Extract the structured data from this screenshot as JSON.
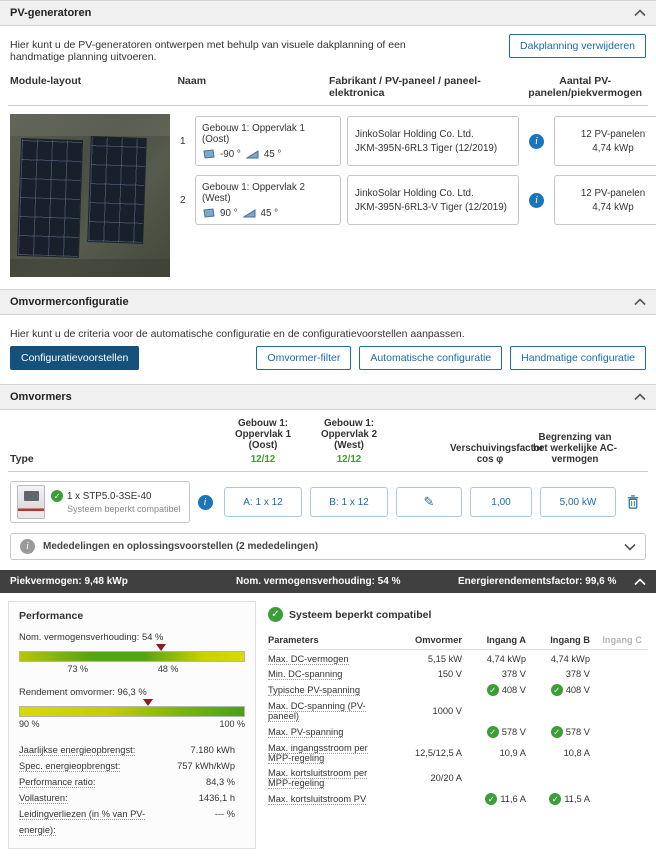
{
  "icons": {
    "check": "✓",
    "info": "i",
    "pencil": "✎"
  },
  "colors": {
    "accent": "#1b6ca8",
    "primary_button": "#14527d",
    "status_green": "#3c9e36",
    "summary_bar": "#404040",
    "marker_red": "#8c1d1d"
  },
  "pv_generators": {
    "title": "PV-generatoren",
    "description": "Hier kunt u de PV-generatoren ontwerpen met behulp van visuele dakplanning of een handmatige planning uitvoeren.",
    "remove_button": "Dakplanning verwijderen",
    "columns": [
      "Module-layout",
      "Naam",
      "Fabrikant / PV-paneel / paneel-elektronica",
      "Aantal PV-panelen/piekvermogen"
    ],
    "rows": [
      {
        "index": "1",
        "name": "Gebouw 1: Oppervlak 1 (Oost)",
        "azimuth": "-90 °",
        "tilt": "45 °",
        "manufacturer": "JinkoSolar Holding Co. Ltd.",
        "panel": "JKM-395N-6RL3 Tiger (12/2019)",
        "count": "12 PV-panelen",
        "power": "4,74 kWp"
      },
      {
        "index": "2",
        "name": "Gebouw 1: Oppervlak 2 (West)",
        "azimuth": "90 °",
        "tilt": "45 °",
        "manufacturer": "JinkoSolar Holding Co. Ltd.",
        "panel": "JKM-395N-6RL3-V Tiger (12/2019)",
        "count": "12 PV-panelen",
        "power": "4,74 kWp"
      }
    ]
  },
  "inverter_config": {
    "title": "Omvormerconfiguratie",
    "description": "Hier kunt u de criteria voor de automatische configuratie en de configuratievoorstellen aanpassen.",
    "buttons": {
      "proposals": "Configuratievoorstellen",
      "filter": "Omvormer-filter",
      "automatic": "Automatische configuratie",
      "manual": "Handmatige configuratie"
    }
  },
  "inverters": {
    "title": "Omvormers",
    "columns": {
      "type": "Type",
      "surface1": "Gebouw 1: Oppervlak 1 (Oost)",
      "surface1_count": "12/12",
      "surface2": "Gebouw 1: Oppervlak 2 (West)",
      "surface2_count": "12/12",
      "cos_phi": "Verschuivingsfactor cos φ",
      "ac_limit": "Begrenzing van het werkelijke AC-vermogen"
    },
    "row": {
      "type_name": "1 x STP5.0-3SE-40",
      "type_status": "Systeem beperkt compatibel",
      "input_a": "A: 1 x 12",
      "input_b": "B: 1 x 12",
      "cos_phi": "1,00",
      "ac_limit": "5,00 kW"
    },
    "messages_label": "Mededelingen en oplossingsvoorstellen (2 mededelingen)"
  },
  "summary_bar": {
    "peak_power": "Piekvermogen: 9,48 kWp",
    "nominal_ratio": "Nom. vermogensverhouding: 54 %",
    "energy_factor": "Energierendementsfactor: 99,6 %"
  },
  "performance": {
    "title": "Performance",
    "nominal_ratio": {
      "label": "Nom. vermogensverhouding: 54 %",
      "tick_left": "73 %",
      "tick_right": "48 %"
    },
    "inverter_efficiency": {
      "label": "Rendement omvormer: 96,3 %",
      "tick_left": "90 %",
      "tick_right": "100 %"
    },
    "stats": [
      {
        "label": "Jaarlijkse energieopbrengst:",
        "value": "7.180 kWh"
      },
      {
        "label": "Spec. energieopbrengst:",
        "value": "757 kWh/kWp"
      },
      {
        "label": "Performance ratio:",
        "value": "84,3 %"
      },
      {
        "label": "Vollasturen:",
        "value": "1436,1 h"
      },
      {
        "label": "Leidingverliezen (in % van PV-energie):",
        "value": "--- %"
      }
    ]
  },
  "system_check": {
    "title": "Systeem beperkt compatibel",
    "columns": [
      "Parameters",
      "Omvormer",
      "Ingang A",
      "Ingang B",
      "Ingang C"
    ],
    "rows": [
      {
        "param": "Max. DC-vermogen",
        "inverter": "5,15 kW",
        "input_a": "4,74 kWp",
        "input_b": "4,74 kWp"
      },
      {
        "param": "Min. DC-spanning",
        "inverter": "150 V",
        "input_a": "378 V",
        "input_b": "378 V"
      },
      {
        "param": "Typische PV-spanning",
        "inverter": "",
        "input_a": "408 V",
        "input_b": "408 V"
      },
      {
        "param": "Max. DC-spanning (PV-paneel)",
        "inverter": "1000 V",
        "input_a": "",
        "input_b": ""
      },
      {
        "param": "Max. PV-spanning",
        "inverter": "",
        "input_a": "578 V",
        "input_b": "578 V"
      },
      {
        "param": "Max. ingangsstroom per MPP-regeling",
        "inverter": "12,5/12,5 A",
        "input_a": "10,9 A",
        "input_b": "10,8 A"
      },
      {
        "param": "Max. kortsluitstroom per MPP-regeling",
        "inverter": "20/20 A",
        "input_a": "",
        "input_b": ""
      },
      {
        "param": "Max. kortsluitstroom PV",
        "inverter": "",
        "input_a": "11,6 A",
        "input_b": "11,5 A"
      }
    ]
  }
}
